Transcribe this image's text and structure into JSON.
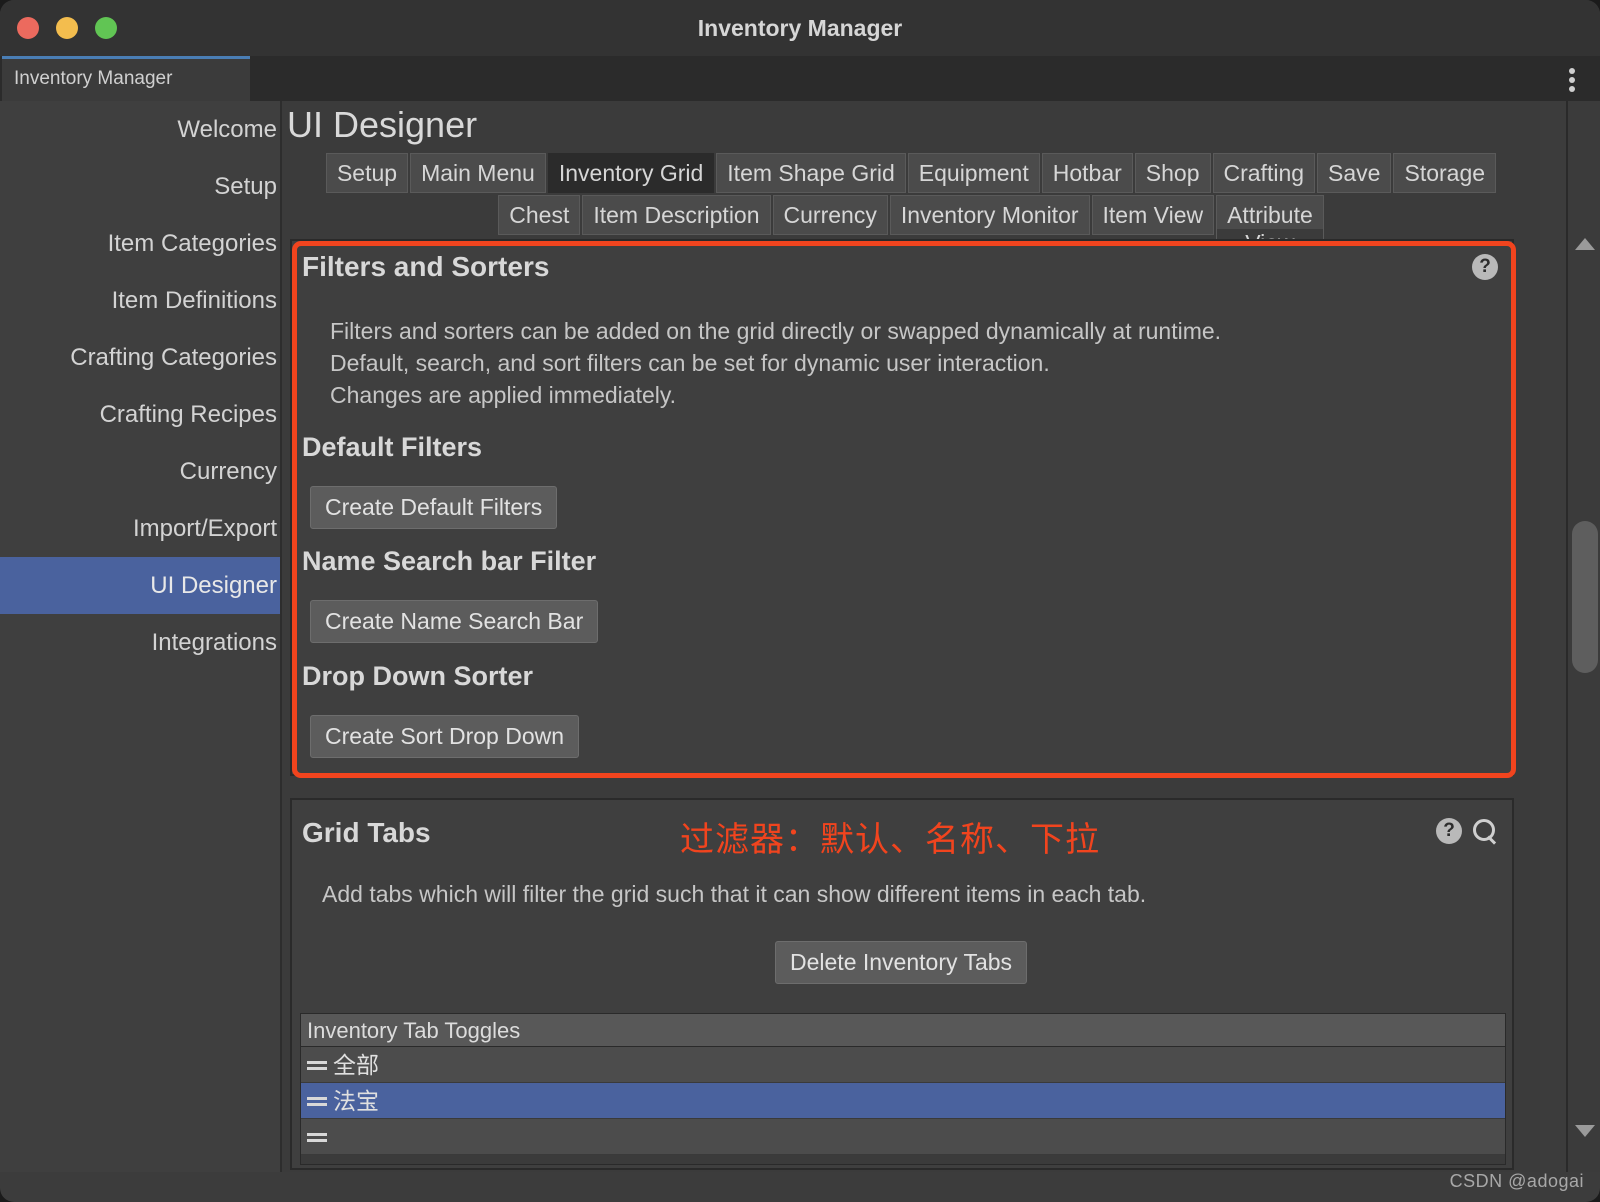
{
  "window": {
    "title": "Inventory Manager",
    "traffic_lights": [
      "close",
      "minimize",
      "maximize"
    ],
    "menu_icon": "kebab-menu-icon"
  },
  "doc_tab": {
    "label": "Inventory Manager"
  },
  "sidebar": {
    "items": [
      {
        "label": "Welcome",
        "selected": false
      },
      {
        "label": "Setup",
        "selected": false
      },
      {
        "label": "Item Categories",
        "selected": false
      },
      {
        "label": "Item Definitions",
        "selected": false
      },
      {
        "label": "Crafting Categories",
        "selected": false
      },
      {
        "label": "Crafting Recipes",
        "selected": false
      },
      {
        "label": "Currency",
        "selected": false
      },
      {
        "label": "Import/Export",
        "selected": false
      },
      {
        "label": "UI Designer",
        "selected": true
      },
      {
        "label": "Integrations",
        "selected": false
      }
    ]
  },
  "page": {
    "title": "UI Designer"
  },
  "tabs": {
    "row1": [
      {
        "label": "Setup",
        "active": false
      },
      {
        "label": "Main Menu",
        "active": false
      },
      {
        "label": "Inventory Grid",
        "active": true
      },
      {
        "label": "Item Shape Grid",
        "active": false
      },
      {
        "label": "Equipment",
        "active": false
      },
      {
        "label": "Hotbar",
        "active": false
      },
      {
        "label": "Shop",
        "active": false
      },
      {
        "label": "Crafting",
        "active": false
      },
      {
        "label": "Save",
        "active": false
      },
      {
        "label": "Storage",
        "active": false
      }
    ],
    "row2": [
      {
        "label": "Chest",
        "active": false
      },
      {
        "label": "Item Description",
        "active": false
      },
      {
        "label": "Currency",
        "active": false
      },
      {
        "label": "Inventory Monitor",
        "active": false
      },
      {
        "label": "Item View",
        "active": false
      }
    ],
    "wrapped_tab": {
      "label": "Attribute",
      "overflow": "View",
      "active": false
    }
  },
  "filters_panel": {
    "title": "Filters and Sorters",
    "help_icon": "?",
    "description": "Filters and sorters can be added on the grid directly or swapped dynamically at runtime.\nDefault, search, and sort filters can be set for dynamic user interaction.\nChanges are applied immediately.",
    "sections": [
      {
        "heading": "Default Filters",
        "button": "Create Default Filters"
      },
      {
        "heading": "Name Search bar Filter",
        "button": "Create Name Search Bar"
      },
      {
        "heading": "Drop Down Sorter",
        "button": "Create Sort Drop Down"
      }
    ],
    "highlight_color": "#f1441e"
  },
  "annotation": {
    "text": "过滤器：默认、名称、下拉",
    "color": "#f1441e"
  },
  "grid_tabs_panel": {
    "title": "Grid Tabs",
    "help_icon": "?",
    "search_icon": "search-icon",
    "description": "Add tabs which will filter the grid such that it can show different items in each tab.",
    "delete_button": "Delete Inventory Tabs",
    "list_header": "Inventory Tab Toggles",
    "rows": [
      {
        "label": "全部",
        "selected": false
      },
      {
        "label": "法宝",
        "selected": true
      },
      {
        "label": "",
        "selected": false
      }
    ]
  },
  "scrollbar": {
    "up_icon": "chevron-up-icon",
    "down_icon": "chevron-down-icon"
  },
  "watermark": {
    "text": "CSDN @adogai"
  },
  "colors": {
    "window_bg": "#333333",
    "panel_bg": "#3f3f3f",
    "accent_selection": "#4a629e",
    "annotation_red": "#f1441e",
    "tab_active_bg": "#2b2b2b"
  }
}
